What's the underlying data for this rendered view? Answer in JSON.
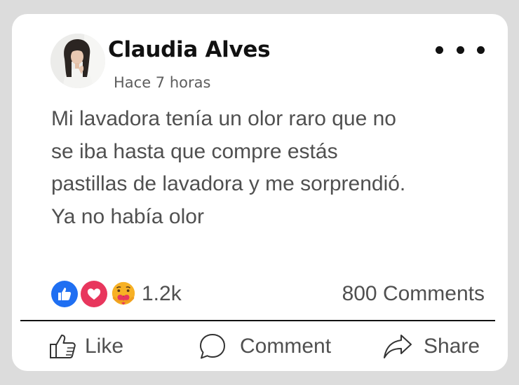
{
  "post": {
    "author": {
      "name": "Claudia Alves",
      "avatar_icon": "profile-photo"
    },
    "timestamp": "Hace 7 horas",
    "more_icon": "more-horizontal-icon",
    "text_lines": [
      "Mi lavadora tenía un olor raro que no",
      "se iba hasta que compre estás",
      "pastillas de lavadora y me sorprendió.",
      "Ya no había olor"
    ]
  },
  "engagement": {
    "reactions": [
      {
        "name": "like",
        "icon": "thumbs-up-icon",
        "color": "#1f6ff2"
      },
      {
        "name": "love",
        "icon": "heart-icon",
        "color": "#e8365d"
      },
      {
        "name": "care",
        "icon": "care-emoji-icon",
        "color": "#f7b125"
      }
    ],
    "reaction_count": "1.2k",
    "comments": "800 Comments"
  },
  "actions": {
    "like": {
      "label": "Like",
      "icon": "thumbs-up-outline-icon"
    },
    "comment": {
      "label": "Comment",
      "icon": "speech-bubble-icon"
    },
    "share": {
      "label": "Share",
      "icon": "share-arrow-icon"
    }
  }
}
